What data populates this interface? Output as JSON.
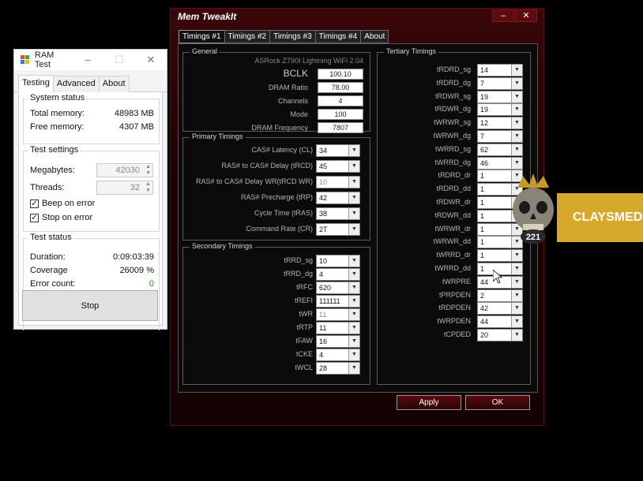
{
  "ramtest": {
    "title": "RAM Test",
    "tabs": [
      "Testing",
      "Advanced",
      "About"
    ],
    "system_status": {
      "title": "System status",
      "total_label": "Total memory:",
      "total_value": "48983 MB",
      "free_label": "Free memory:",
      "free_value": "4307 MB"
    },
    "test_settings": {
      "title": "Test settings",
      "mb_label": "Megabytes:",
      "mb_value": "42030",
      "threads_label": "Threads:",
      "threads_value": "32",
      "beep_label": "Beep on error",
      "stop_label": "Stop on error"
    },
    "test_status": {
      "title": "Test status",
      "duration_label": "Duration:",
      "duration_value": "0:09:03:39",
      "coverage_label": "Coverage",
      "coverage_value": "26009 %",
      "errors_label": "Error count:",
      "errors_value": "0"
    },
    "stop_button": "Stop"
  },
  "memtweak": {
    "title": "Mem TweakIt",
    "tabs": [
      "Timings #1",
      "Timings #2",
      "Timings #3",
      "Timings #4",
      "About"
    ],
    "general": {
      "title": "General",
      "board": "ASRock Z790I Lightning WiFi 2.04",
      "rows": [
        {
          "label": "BCLK",
          "value": "100.10"
        },
        {
          "label": "DRAM Ratio",
          "value": "78.00"
        },
        {
          "label": "Channels",
          "value": "4"
        },
        {
          "label": "Mode",
          "value": "100"
        },
        {
          "label": "DRAM Frequency",
          "value": "7807"
        }
      ]
    },
    "primary": {
      "title": "Primary Timings",
      "rows": [
        {
          "label": "CAS# Latency (CL)",
          "value": "34"
        },
        {
          "label": "RAS# to CAS# Delay (tRCD)",
          "value": "45"
        },
        {
          "label": "RAS# to CAS# Delay WR(tRCD WR)",
          "value": "10"
        },
        {
          "label": "RAS# Precharge (tRP)",
          "value": "42"
        },
        {
          "label": "Cycle Time (tRAS)",
          "value": "38"
        },
        {
          "label": "Command Rate (CR)",
          "value": "2T"
        }
      ]
    },
    "secondary": {
      "title": "Secondary Timings",
      "rows": [
        {
          "label": "tRRD_sg",
          "value": "10"
        },
        {
          "label": "tRRD_dg",
          "value": "4"
        },
        {
          "label": "tRFC",
          "value": "620"
        },
        {
          "label": "tREFI",
          "value": "111111"
        },
        {
          "label": "tWR",
          "value": "11"
        },
        {
          "label": "tRTP",
          "value": "11"
        },
        {
          "label": "tFAW",
          "value": "16"
        },
        {
          "label": "tCKE",
          "value": "4"
        },
        {
          "label": "tWCL",
          "value": "28"
        }
      ]
    },
    "tertiary": {
      "title": "Tertiary Timings",
      "rows": [
        {
          "label": "tRDRD_sg",
          "value": "14"
        },
        {
          "label": "tRDRD_dg",
          "value": "7"
        },
        {
          "label": "tRDWR_sg",
          "value": "19"
        },
        {
          "label": "tRDWR_dg",
          "value": "19"
        },
        {
          "label": "tWRWR_sg",
          "value": "12"
        },
        {
          "label": "tWRWR_dg",
          "value": "7"
        },
        {
          "label": "tWRRD_sg",
          "value": "62"
        },
        {
          "label": "tWRRD_dg",
          "value": "46"
        },
        {
          "label": "tRDRD_dr",
          "value": "1"
        },
        {
          "label": "tRDRD_dd",
          "value": "1"
        },
        {
          "label": "tRDWR_dr",
          "value": "1"
        },
        {
          "label": "tRDWR_dd",
          "value": "1"
        },
        {
          "label": "tWRWR_dr",
          "value": "1"
        },
        {
          "label": "tWRWR_dd",
          "value": "1"
        },
        {
          "label": "tWRRD_dr",
          "value": "1"
        },
        {
          "label": "tWRRD_dd",
          "value": "1"
        },
        {
          "label": "tWRPRE",
          "value": "44"
        },
        {
          "label": "tPRPDEN",
          "value": "2"
        },
        {
          "label": "tRDPDEN",
          "value": "42"
        },
        {
          "label": "tWRPDEN",
          "value": "44"
        },
        {
          "label": "tCPDED",
          "value": "20"
        }
      ]
    },
    "apply_button": "Apply",
    "ok_button": "OK"
  },
  "overlay": {
    "badge_text": "CLAYSMEDI",
    "badge_number": "221",
    "badge_color": "#d7a92a"
  }
}
